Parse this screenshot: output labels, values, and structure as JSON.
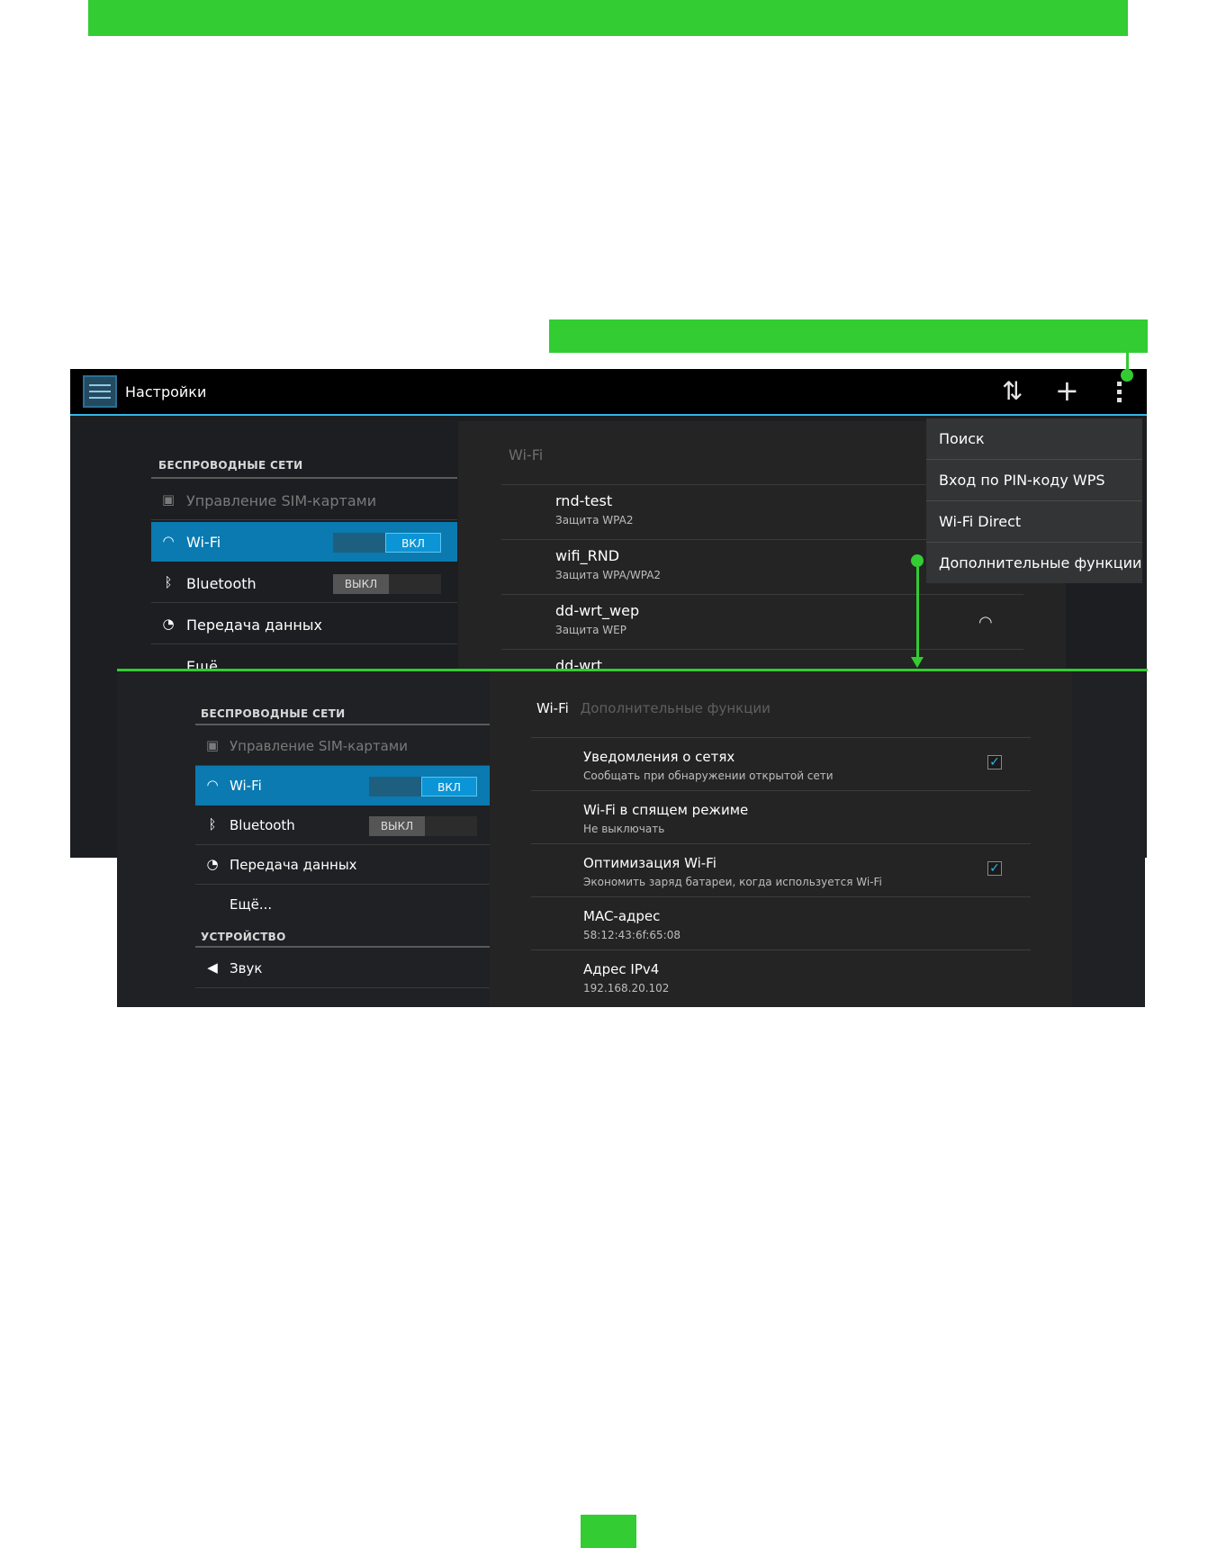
{
  "colors": {
    "accent_green": "#33cc33",
    "holo_blue": "#33b5e5",
    "selected_row": "#0a7ab1"
  },
  "topbar": {
    "title": "Настройки",
    "icons": [
      "settings-app-icon",
      "sync-icon",
      "add-icon",
      "overflow-menu-icon"
    ]
  },
  "overflow_menu": {
    "items": [
      "Поиск",
      "Вход по PIN-коду WPS",
      "Wi-Fi Direct",
      "Дополнительные функции"
    ]
  },
  "screen1": {
    "section_wireless": "БЕСПРОВОДНЫЕ СЕТИ",
    "nav": {
      "sim": "Управление SIM-картами",
      "wifi": "Wi-Fi",
      "wifi_toggle": "ВКЛ",
      "bluetooth": "Bluetooth",
      "bluetooth_toggle": "ВЫКЛ",
      "data": "Передача данных",
      "more": "Ещё..."
    },
    "right_title": "Wi-Fi",
    "networks": [
      {
        "name": "rnd-test",
        "security": "Защита WPA2"
      },
      {
        "name": "wifi_RND",
        "security": "Защита WPA/WPA2"
      },
      {
        "name": "dd-wrt_wep",
        "security": "Защита WEP"
      },
      {
        "name": "dd-wrt",
        "security": ""
      }
    ]
  },
  "screen2": {
    "section_wireless": "БЕСПРОВОДНЫЕ СЕТИ",
    "section_device": "УСТРОЙСТВО",
    "nav": {
      "sim": "Управление SIM-картами",
      "wifi": "Wi-Fi",
      "wifi_toggle": "ВКЛ",
      "bluetooth": "Bluetooth",
      "bluetooth_toggle": "ВЫКЛ",
      "data": "Передача данных",
      "more": "Ещё...",
      "sound": "Звук"
    },
    "breadcrumb": {
      "root": "Wi-Fi",
      "current": "Дополнительные функции"
    },
    "options": [
      {
        "title": "Уведомления о сетях",
        "summary": "Сообщать при обнаружении открытой сети",
        "checked": true
      },
      {
        "title": "Wi-Fi в спящем режиме",
        "summary": "Не выключать",
        "checked": null
      },
      {
        "title": "Оптимизация Wi-Fi",
        "summary": "Экономить заряд батареи, когда используется Wi-Fi",
        "checked": true
      },
      {
        "title": "MAC-адрес",
        "summary": "58:12:43:6f:65:08",
        "checked": null
      },
      {
        "title": "Адрес IPv4",
        "summary": "192.168.20.102",
        "checked": null
      }
    ]
  }
}
